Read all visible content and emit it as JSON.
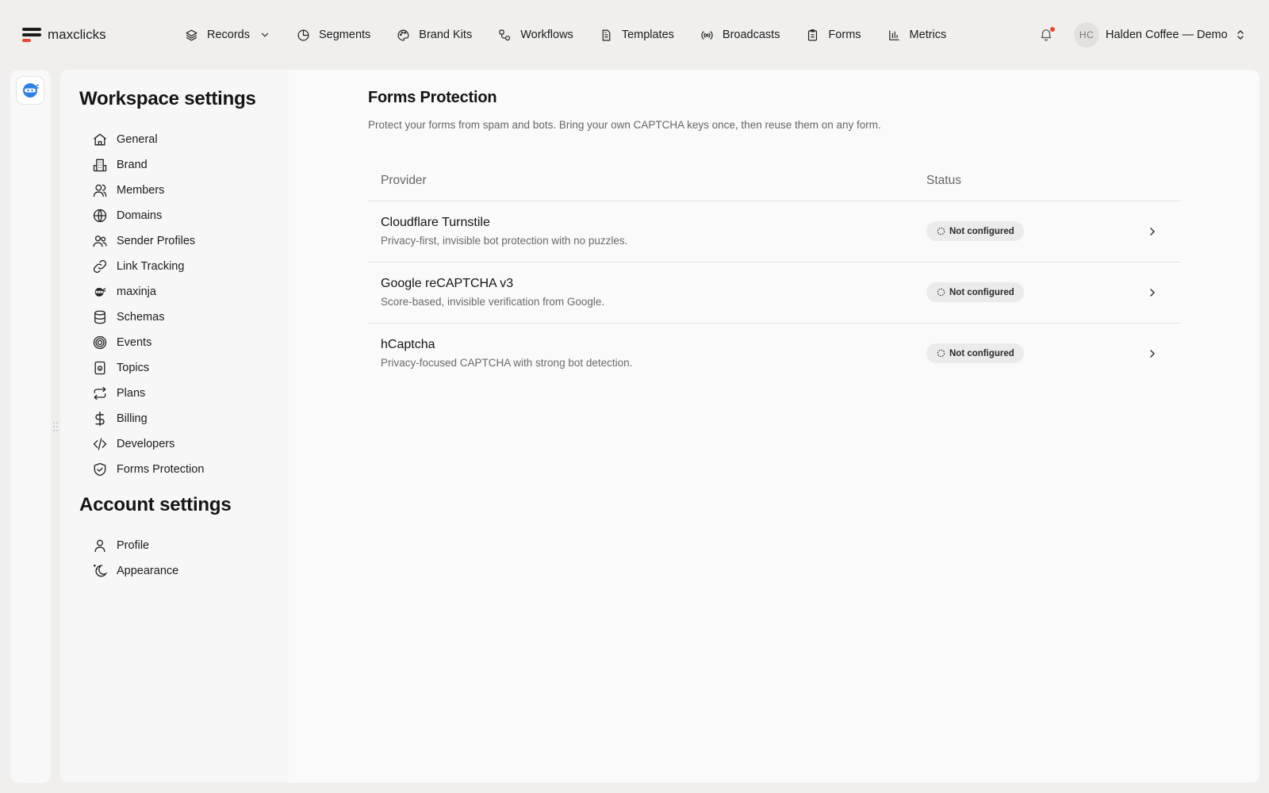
{
  "app": {
    "logo_text": "maxclicks"
  },
  "nav": {
    "items": [
      {
        "label": "Records",
        "icon": "layers-icon"
      },
      {
        "label": "Segments",
        "icon": "pie-icon"
      },
      {
        "label": "Brand Kits",
        "icon": "palette-icon"
      },
      {
        "label": "Workflows",
        "icon": "workflow-icon"
      },
      {
        "label": "Templates",
        "icon": "document-icon"
      },
      {
        "label": "Broadcasts",
        "icon": "broadcast-icon"
      },
      {
        "label": "Forms",
        "icon": "clipboard-icon"
      },
      {
        "label": "Metrics",
        "icon": "bar-chart-icon"
      }
    ]
  },
  "account": {
    "initials": "HC",
    "name": "Halden Coffee — Demo"
  },
  "sidebar": {
    "workspace_title": "Workspace settings",
    "workspace_items": [
      {
        "label": "General",
        "icon": "home-icon"
      },
      {
        "label": "Brand",
        "icon": "building-icon"
      },
      {
        "label": "Members",
        "icon": "users-icon"
      },
      {
        "label": "Domains",
        "icon": "globe-icon"
      },
      {
        "label": "Sender Profiles",
        "icon": "user-group-icon"
      },
      {
        "label": "Link Tracking",
        "icon": "link-icon"
      },
      {
        "label": "maxinja",
        "icon": "ninja-icon"
      },
      {
        "label": "Schemas",
        "icon": "database-icon"
      },
      {
        "label": "Events",
        "icon": "target-icon"
      },
      {
        "label": "Topics",
        "icon": "topic-icon"
      },
      {
        "label": "Plans",
        "icon": "repeat-icon"
      },
      {
        "label": "Billing",
        "icon": "dollar-icon"
      },
      {
        "label": "Developers",
        "icon": "code-icon"
      },
      {
        "label": "Forms Protection",
        "icon": "shield-check-icon"
      }
    ],
    "account_title": "Account settings",
    "account_items": [
      {
        "label": "Profile",
        "icon": "user-icon"
      },
      {
        "label": "Appearance",
        "icon": "moon-icon"
      }
    ]
  },
  "main": {
    "title": "Forms Protection",
    "description": "Protect your forms from spam and bots. Bring your own CAPTCHA keys once, then reuse them on any form.",
    "table": {
      "columns": [
        "Provider",
        "Status"
      ],
      "rows": [
        {
          "name": "Cloudflare Turnstile",
          "description": "Privacy-first, invisible bot protection with no puzzles.",
          "status": "Not configured"
        },
        {
          "name": "Google reCAPTCHA v3",
          "description": "Score-based, invisible verification from Google.",
          "status": "Not configured"
        },
        {
          "name": "hCaptcha",
          "description": "Privacy-focused CAPTCHA with strong bot detection.",
          "status": "Not configured"
        }
      ]
    }
  },
  "colors": {
    "accent": "#e8472b",
    "brand_blue": "#2f7fe6",
    "background": "#f0efee"
  }
}
